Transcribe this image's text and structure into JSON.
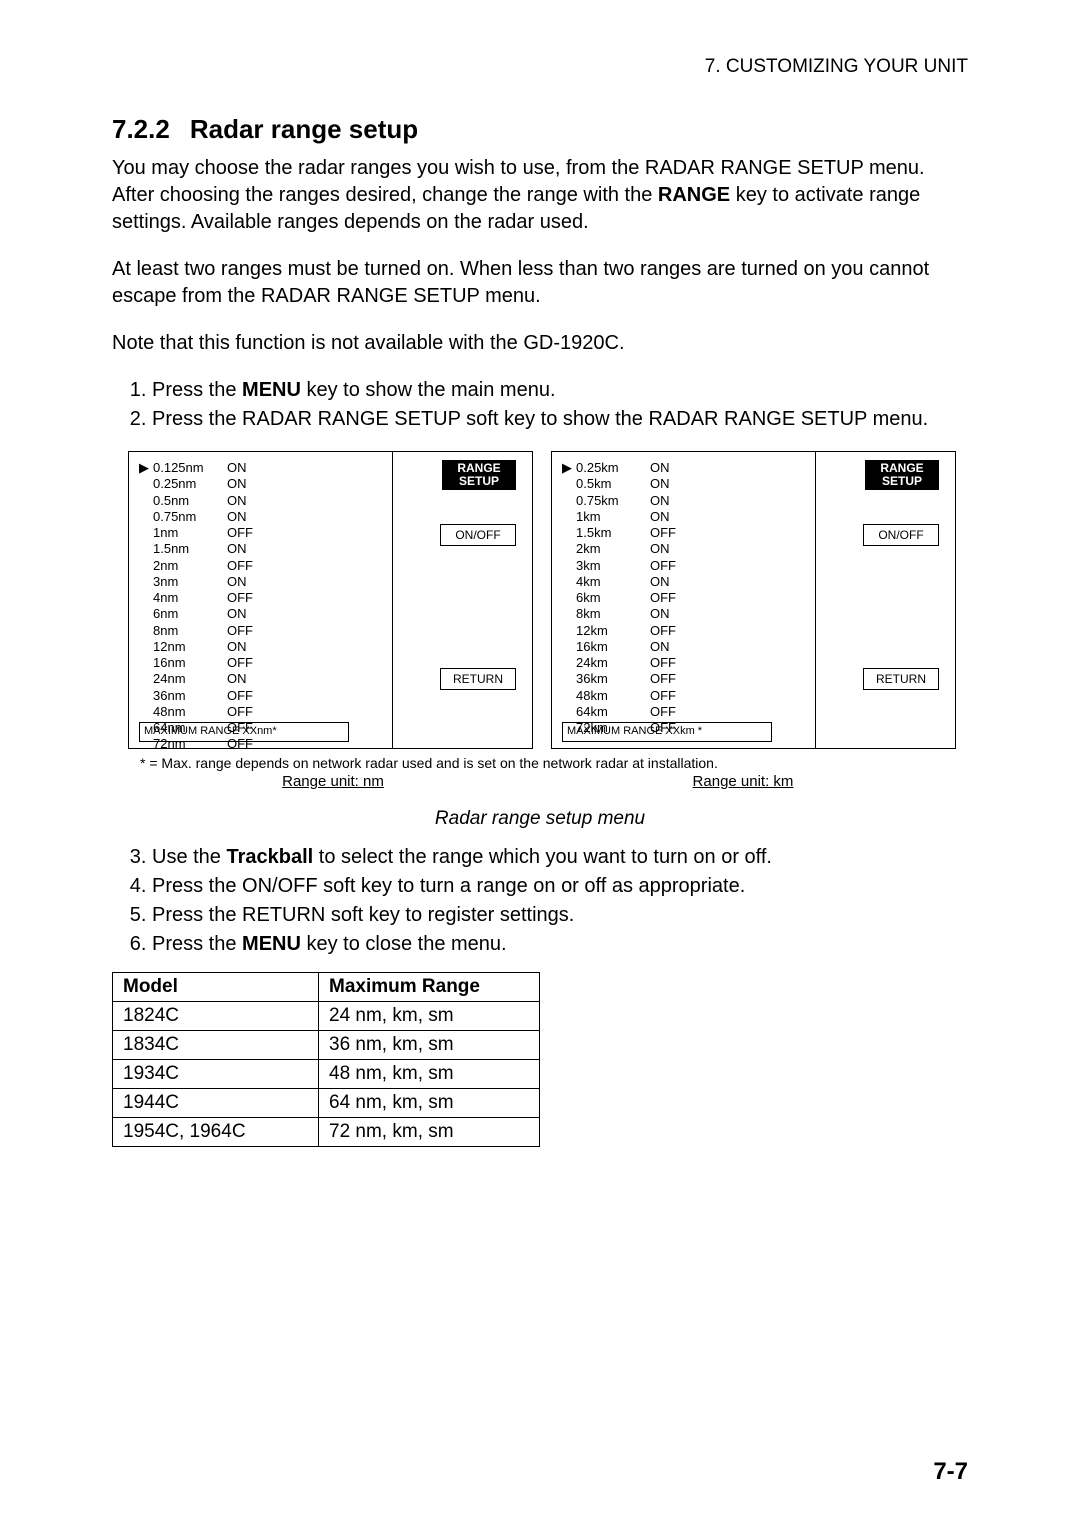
{
  "header": {
    "chapter": "7. CUSTOMIZING YOUR UNIT"
  },
  "section": {
    "number": "7.2.2",
    "title": "Radar range setup"
  },
  "paragraphs": {
    "p1a": "You may choose the radar ranges you wish to use, from the RADAR RANGE SETUP menu. After choosing the ranges desired, change the range with the ",
    "p1b": "RANGE",
    "p1c": " key to activate range settings. Available ranges depends on the radar used.",
    "p2": "At least two ranges must be turned on. When less than two ranges are turned on you cannot escape from the RADAR RANGE SETUP menu.",
    "p3": "Note that this function is not available with the GD-1920C."
  },
  "steps_a": [
    {
      "pre": "Press the ",
      "bold": "MENU",
      "post": " key to show the main menu."
    },
    {
      "pre": "Press the RADAR RANGE SETUP soft key to show the RADAR RANGE SETUP menu.",
      "bold": "",
      "post": ""
    }
  ],
  "figure": {
    "softkeys": {
      "range_setup_l1": "RANGE",
      "range_setup_l2": "SETUP",
      "onoff": "ON/OFF",
      "return": "RETURN"
    },
    "nm_ranges": [
      {
        "sel": "▶",
        "name": "0.125nm",
        "state": "ON"
      },
      {
        "sel": "",
        "name": "0.25nm",
        "state": "ON"
      },
      {
        "sel": "",
        "name": "0.5nm",
        "state": "ON"
      },
      {
        "sel": "",
        "name": "0.75nm",
        "state": "ON"
      },
      {
        "sel": "",
        "name": "1nm",
        "state": "OFF"
      },
      {
        "sel": "",
        "name": "1.5nm",
        "state": "ON"
      },
      {
        "sel": "",
        "name": "2nm",
        "state": "OFF"
      },
      {
        "sel": "",
        "name": "3nm",
        "state": "ON"
      },
      {
        "sel": "",
        "name": "4nm",
        "state": "OFF"
      },
      {
        "sel": "",
        "name": "6nm",
        "state": "ON"
      },
      {
        "sel": "",
        "name": "8nm",
        "state": "OFF"
      },
      {
        "sel": "",
        "name": "12nm",
        "state": "ON"
      },
      {
        "sel": "",
        "name": "16nm",
        "state": "OFF"
      },
      {
        "sel": "",
        "name": "24nm",
        "state": "ON"
      },
      {
        "sel": "",
        "name": "36nm",
        "state": "OFF"
      },
      {
        "sel": "",
        "name": "48nm",
        "state": "OFF"
      },
      {
        "sel": "",
        "name": "64nm",
        "state": "OFF"
      },
      {
        "sel": "",
        "name": "72nm",
        "state": "OFF"
      }
    ],
    "nm_max": "MAXIMUM RANGE XXnm*",
    "km_ranges": [
      {
        "sel": "▶",
        "name": "0.25km",
        "state": "ON"
      },
      {
        "sel": "",
        "name": "0.5km",
        "state": "ON"
      },
      {
        "sel": "",
        "name": "0.75km",
        "state": "ON"
      },
      {
        "sel": "",
        "name": "1km",
        "state": "ON"
      },
      {
        "sel": "",
        "name": "1.5km",
        "state": "OFF"
      },
      {
        "sel": "",
        "name": "2km",
        "state": "ON"
      },
      {
        "sel": "",
        "name": "3km",
        "state": "OFF"
      },
      {
        "sel": "",
        "name": "4km",
        "state": "ON"
      },
      {
        "sel": "",
        "name": "6km",
        "state": "OFF"
      },
      {
        "sel": "",
        "name": "8km",
        "state": "ON"
      },
      {
        "sel": "",
        "name": "12km",
        "state": "OFF"
      },
      {
        "sel": "",
        "name": "16km",
        "state": "ON"
      },
      {
        "sel": "",
        "name": "24km",
        "state": "OFF"
      },
      {
        "sel": "",
        "name": "36km",
        "state": "OFF"
      },
      {
        "sel": "",
        "name": "48km",
        "state": "OFF"
      },
      {
        "sel": "",
        "name": "64km",
        "state": "OFF"
      },
      {
        "sel": "",
        "name": "72km",
        "state": "OFF"
      }
    ],
    "km_max": "MAXIMUM RANGE XXkm *",
    "footnote": "* = Max. range depends on network radar used and is set on the network radar at installation.",
    "unit_nm": "Range unit: nm",
    "unit_km": "Range unit: km",
    "caption": "Radar range setup menu"
  },
  "steps_b": [
    {
      "pre": "Use the ",
      "bold": "Trackball",
      "post": " to select the range which you want to turn on or off."
    },
    {
      "pre": "Press the ON/OFF soft key to turn a range on or off as appropriate.",
      "bold": "",
      "post": ""
    },
    {
      "pre": "Press the RETURN soft key to register settings.",
      "bold": "",
      "post": ""
    },
    {
      "pre": "Press the ",
      "bold": "MENU",
      "post": " key to close the menu."
    }
  ],
  "model_table": {
    "head_model": "Model",
    "head_range": "Maximum Range",
    "rows": [
      {
        "model": "1824C",
        "range": "24 nm, km, sm"
      },
      {
        "model": "1834C",
        "range": "36 nm, km, sm"
      },
      {
        "model": "1934C",
        "range": "48 nm, km, sm"
      },
      {
        "model": "1944C",
        "range": "64 nm, km, sm"
      },
      {
        "model": "1954C, 1964C",
        "range": "72 nm, km, sm"
      }
    ]
  },
  "page_number": "7-7"
}
